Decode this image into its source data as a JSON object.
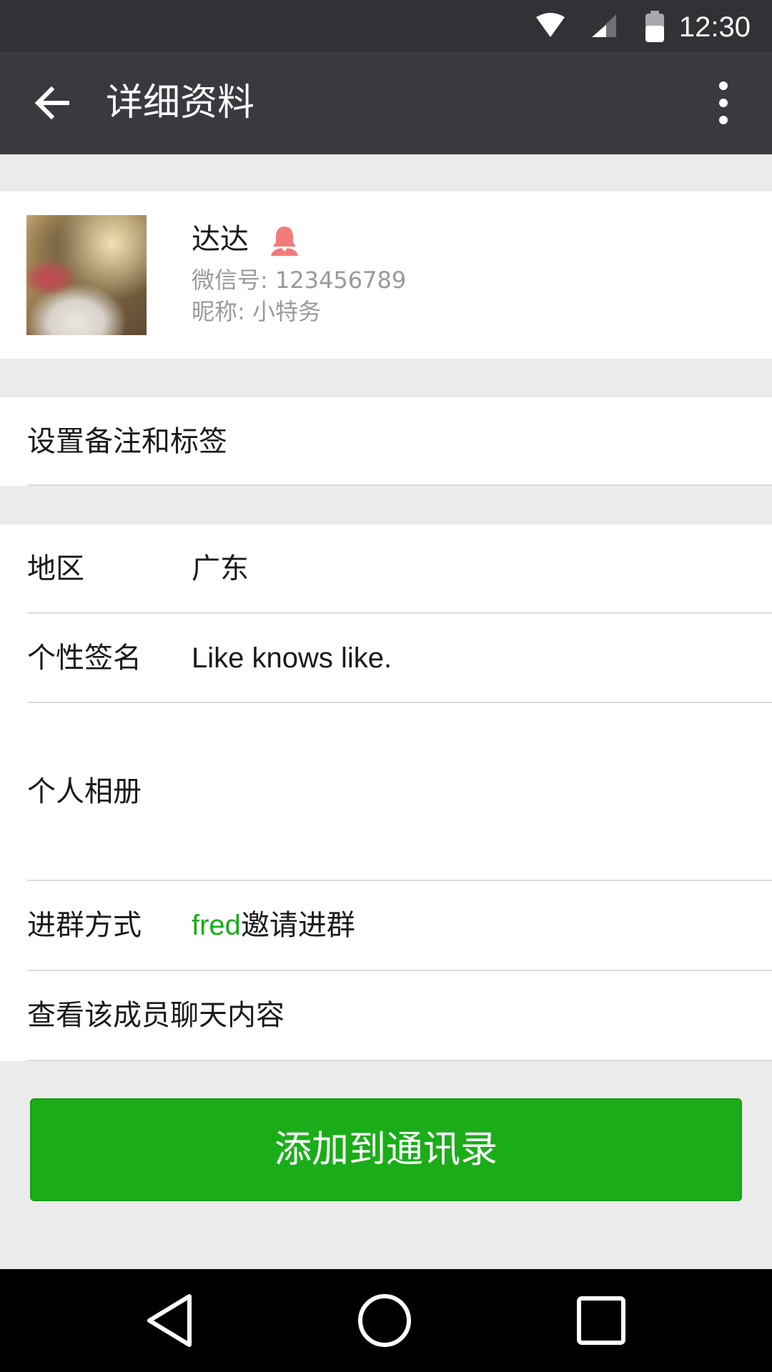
{
  "status_bar": {
    "time": "12:30"
  },
  "toolbar": {
    "title": "详细资料",
    "back_icon": "arrow-left-icon",
    "more_icon": "more-vertical-icon"
  },
  "profile": {
    "name": "达达",
    "wechat_id": "微信号: 123456789",
    "nickname": "昵称: 小特务",
    "gender_icon": "female-icon"
  },
  "set_remark": {
    "label": "设置备注和标签"
  },
  "region": {
    "label": "地区",
    "value": "广东"
  },
  "signature": {
    "label": "个性签名",
    "value": "Like knows like."
  },
  "album": {
    "label": "个人相册"
  },
  "join_method": {
    "label": "进群方式",
    "inviter": "fred",
    "suffix": "邀请进群"
  },
  "chat_history": {
    "label": "查看该成员聊天内容"
  },
  "add_button": {
    "label": "添加到通讯录"
  },
  "colors": {
    "accent": "#1aad19",
    "toolbar": "#393a3f",
    "status_bar": "#303235",
    "gender_icon": "#f37b7b"
  }
}
